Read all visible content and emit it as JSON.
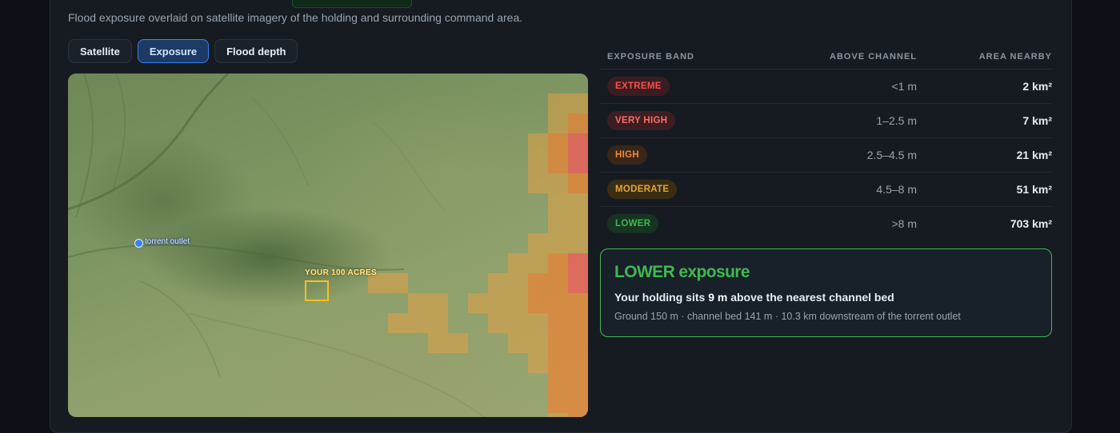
{
  "header": {
    "subtitle": "Flood exposure overlaid on satellite imagery of the holding and surrounding command area."
  },
  "tabs": [
    {
      "label": "Satellite",
      "active": false
    },
    {
      "label": "Exposure",
      "active": true
    },
    {
      "label": "Flood depth",
      "active": false
    }
  ],
  "map": {
    "outlet_label": "torrent outlet",
    "holding_label": "YOUR 100 ACRES"
  },
  "table": {
    "headers": [
      "EXPOSURE BAND",
      "ABOVE CHANNEL",
      "AREA NEARBY"
    ],
    "rows": [
      {
        "band": "EXTREME",
        "above": "<1 m",
        "area": "2 km²",
        "color": "#f85149",
        "bg": "#3a1d22"
      },
      {
        "band": "VERY HIGH",
        "above": "1–2.5 m",
        "area": "7 km²",
        "color": "#ff6b6b",
        "bg": "#3a1e22"
      },
      {
        "band": "HIGH",
        "above": "2.5–4.5 m",
        "area": "21 km²",
        "color": "#f0883e",
        "bg": "#3a2618"
      },
      {
        "band": "MODERATE",
        "above": "4.5–8 m",
        "area": "51 km²",
        "color": "#e3a53b",
        "bg": "#3a2d14"
      },
      {
        "band": "LOWER",
        "above": ">8 m",
        "area": "703 km²",
        "color": "#3fb950",
        "bg": "#173322"
      }
    ]
  },
  "summary": {
    "title": "LOWER exposure",
    "line_prefix": "Your holding sits",
    "line_value": "9 m",
    "line_suffix": "above the nearest channel bed",
    "detail": "Ground 150 m · channel bed 141 m · 10.3 km downstream of the torrent outlet",
    "color": "#3fb950"
  }
}
